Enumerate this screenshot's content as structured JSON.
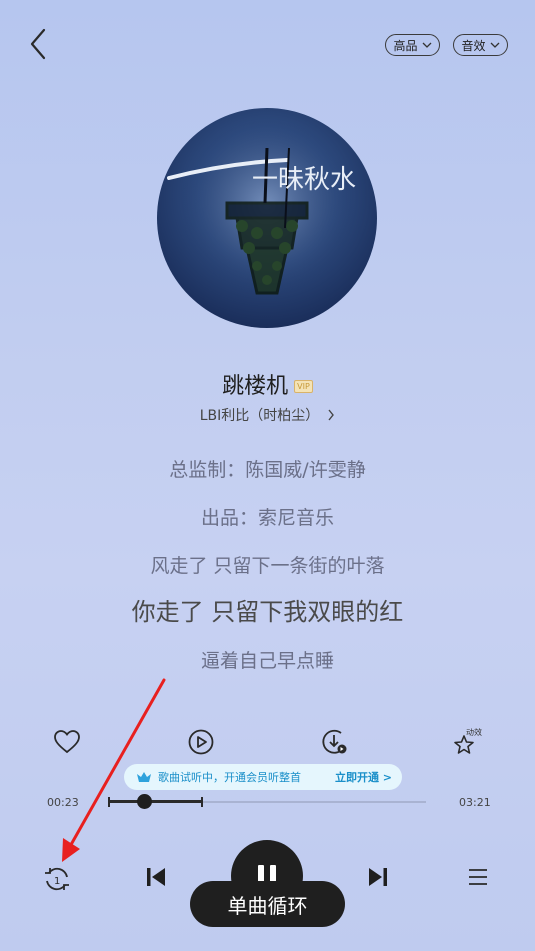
{
  "header": {
    "quality_label": "高品",
    "effect_label": "音效"
  },
  "album": {
    "cover_text": "一昧秋水"
  },
  "song": {
    "title": "跳楼机",
    "vip_badge": "VIP",
    "artist": "LBI利比（时柏尘）"
  },
  "lyrics": [
    "总监制：陈国威/许雯静",
    "出品：索尼音乐",
    "风走了 只留下一条街的叶落",
    "你走了 只留下我双眼的红",
    "逼着自己早点睡"
  ],
  "actions": {
    "animation_label": "动效"
  },
  "vip_banner": {
    "text": "歌曲试听中，开通会员听整首",
    "cta": "立即开通 >"
  },
  "progress": {
    "elapsed": "00:23",
    "duration": "03:21",
    "played_fraction": 0.114,
    "trial_start_fraction": 0.0,
    "trial_end_fraction": 0.3
  },
  "player": {
    "mode_toast": "单曲循环",
    "state": "playing"
  },
  "colors": {
    "arrow": "#e8201f",
    "vip_banner_bg": "#e5f6fd",
    "vip_banner_text": "#1a8fc9"
  }
}
